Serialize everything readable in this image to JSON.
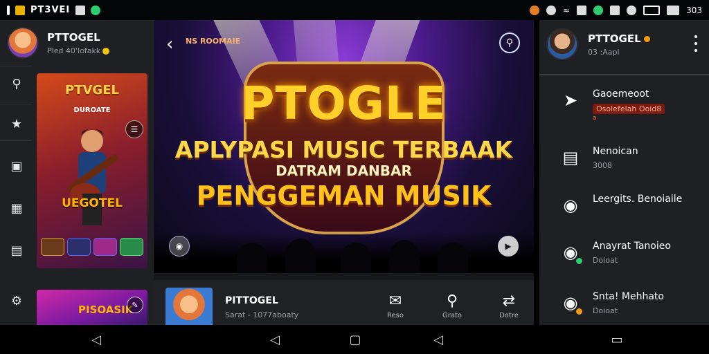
{
  "statusbar": {
    "app_title": "PT3VEI",
    "right_text": "303"
  },
  "left_panel": {
    "profile": {
      "name": "PTTOGEL",
      "sub": "Pled 40'Iofakk"
    },
    "nav_icons": [
      "search-icon",
      "star-icon",
      "playlist-icon",
      "library-icon",
      "devices-icon",
      "settings-icon"
    ],
    "poster": {
      "title": "PTVGEL",
      "subtitle": "DUROATE",
      "name": "UEGOTEL"
    },
    "poster2": {
      "title": "PISOASIK"
    }
  },
  "banner": {
    "brand": "NS ROOMAIE",
    "line1": "PTOGLE",
    "line2": "APLYPASI MUSIC TERBAAK",
    "line3": "DATRAM DANBAR",
    "line4": "PENGGEMAN MUSIK"
  },
  "player": {
    "name": "PITTOGEL",
    "sub": "Sarat - 1077aboaty",
    "controls": [
      {
        "icon": "chat-icon",
        "label": "Reso"
      },
      {
        "icon": "search-icon",
        "label": "Grato"
      },
      {
        "icon": "share-icon",
        "label": "Dotre"
      }
    ]
  },
  "right_panel": {
    "profile": {
      "name": "PTTOGEL",
      "sub": "03 :Aapl"
    },
    "items": [
      {
        "icon": "rocket-icon",
        "title": "Gaoemeoot",
        "sub": "Osolefelah Ooid8",
        "sub2": "a"
      },
      {
        "icon": "inbox-icon",
        "title": "Nenoican",
        "sub": "3008"
      },
      {
        "icon": "camera-icon",
        "title": "Leergits. Benoiaile",
        "sub": ""
      },
      {
        "icon": "camera-badge-icon",
        "title": "Anayrat Tanoieo",
        "sub": "Doioat"
      },
      {
        "icon": "camera-badge-icon",
        "title": "Snta! Mehhato",
        "sub": "Doioat"
      }
    ]
  },
  "colors": {
    "panel_bg": "#1e2024",
    "accent_gold": "#ffcf2a",
    "badge_green": "#2ecc71",
    "badge_orange": "#f39c12"
  }
}
